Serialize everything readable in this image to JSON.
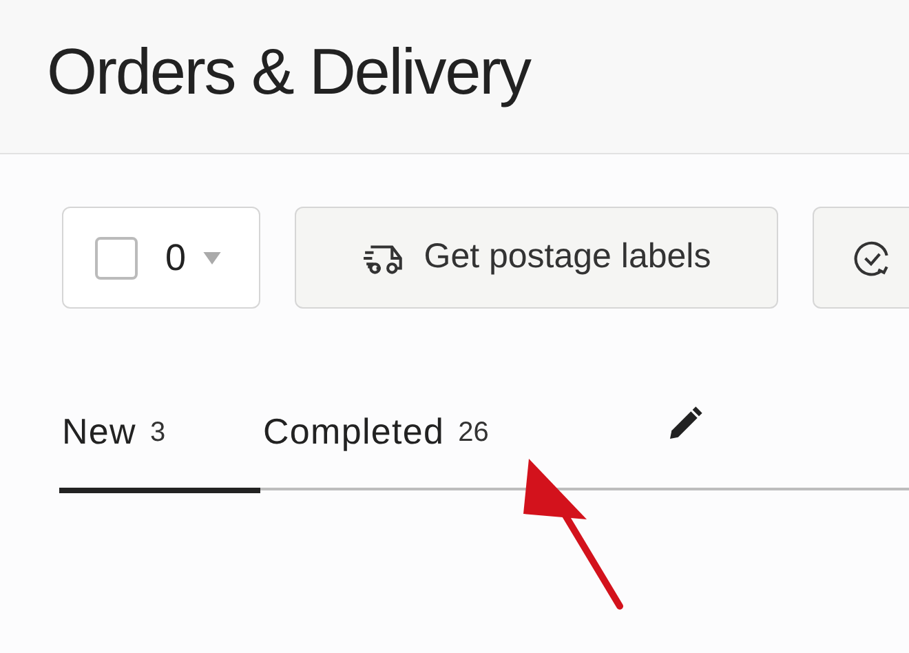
{
  "page": {
    "title": "Orders & Delivery"
  },
  "toolbar": {
    "select_all": {
      "checked": false,
      "count": "0"
    },
    "postage_button": {
      "label": "Get postage labels"
    }
  },
  "tabs": [
    {
      "label": "New",
      "count": "3",
      "selected": true
    },
    {
      "label": "Completed",
      "count": "26",
      "selected": false
    }
  ]
}
